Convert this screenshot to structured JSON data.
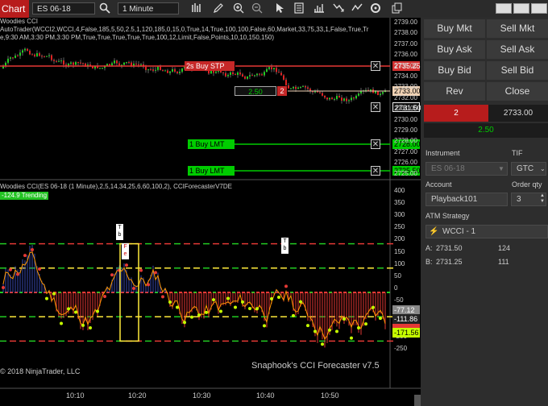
{
  "toolbar": {
    "title": "Chart",
    "instrument": "ES 06-18",
    "interval": "1 Minute"
  },
  "chart": {
    "indicator_title": "Woodies CCI",
    "indicator_params_1": "AutoTrader(WCCI2,WCCI,4,False,185,5,50,2.5,1,120,185,0,15,0,True,14,True,100,100,False,60,Market,33,75,33,1,False,True,Tr",
    "indicator_params_2": "e,9:30 AM,3:30 PM,3:30 PM,True,True,True,True,True,100,12,Limit,False,Points,10,10,150,150)",
    "upper_ticks": [
      "2739.00",
      "2738.00",
      "2737.00",
      "2736.00",
      "2735.00",
      "2734.00",
      "2733.00",
      "2732.00",
      "2731.00",
      "2730.00",
      "2729.00",
      "2728.00",
      "2727.00",
      "2726.00",
      "2725.00"
    ],
    "buy_stp_label": "2s  Buy STP",
    "buy_stp_price": "2735.25",
    "pos_pnl": "2.50",
    "pos_qty": "2",
    "avg_price": "2733.00",
    "last_price": "2731.50",
    "buy_lmt_1_label": "1  Buy LMT",
    "buy_lmt_1_price": "2728.00",
    "buy_lmt_2_label": "1  Buy LMT",
    "buy_lmt_2_price": "2725.50",
    "lower_title": "Woodies CCI(ES 06-18 (1 Minute),2,5,14,34,25,6,60,100,2), CCIForecasterV7DE",
    "trend_badge": "-124.9 Trending",
    "lower_ticks": [
      "400",
      "350",
      "300",
      "250",
      "200",
      "150",
      "100",
      "50",
      "0",
      "-50",
      "-100",
      "-150",
      "-200",
      "-250"
    ],
    "cci_value_1": "-77.12",
    "cci_value_2": "-111.86",
    "cci_value_3": "-171.56",
    "time_labels": [
      "10:10",
      "10:20",
      "10:30",
      "10:40",
      "10:50"
    ],
    "copyright": "© 2018 NinjaTrader, LLC",
    "watermark": "Snaphook's CCI Forecaster v7.5",
    "marker_1": "T\nb",
    "marker_2": "F\ne",
    "marker_3": "T\nb"
  },
  "panel": {
    "buy_mkt": "Buy Mkt",
    "sell_mkt": "Sell Mkt",
    "buy_ask": "Buy Ask",
    "sell_ask": "Sell Ask",
    "buy_bid": "Buy Bid",
    "sell_bid": "Sell Bid",
    "rev": "Rev",
    "close": "Close",
    "position_qty": "2",
    "position_price": "2733.00",
    "position_pnl": "2.50",
    "instrument_label": "Instrument",
    "tif_label": "TIF",
    "instrument_value": "ES 06-18",
    "tif_value": "GTC",
    "account_label": "Account",
    "order_qty_label": "Order qty",
    "account_value": "Playback101",
    "order_qty_value": "3",
    "atm_label": "ATM Strategy",
    "atm_value": "WCCI - 1",
    "ask_label": "A:",
    "ask_price": "2731.50",
    "ask_size": "124",
    "bid_label": "B:",
    "bid_price": "2731.25",
    "bid_size": "111"
  },
  "colors": {
    "bull_candle": "#22cc22",
    "bear_candle": "#dd2222",
    "accent_red": "#c62828",
    "accent_green": "#00cc00"
  }
}
